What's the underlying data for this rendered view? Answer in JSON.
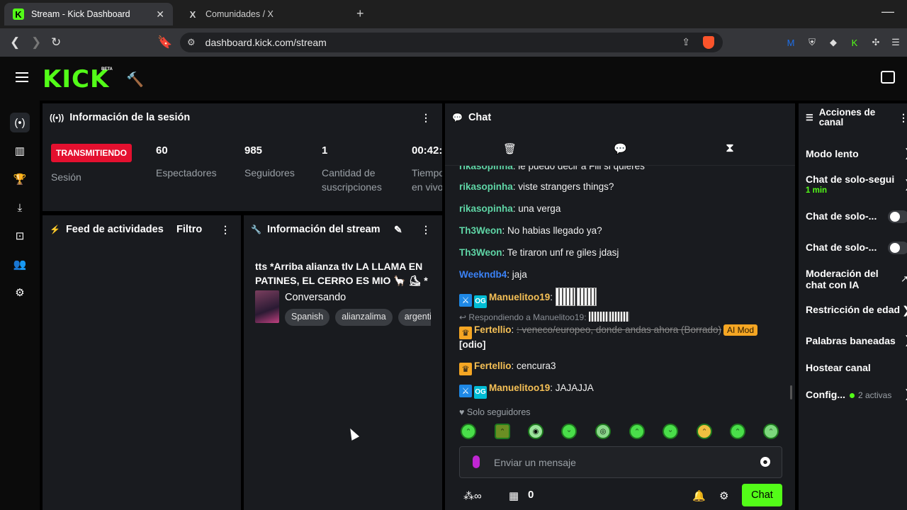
{
  "browser": {
    "tabs": [
      {
        "title": "Stream - Kick Dashboard",
        "favicon": "K"
      },
      {
        "title": "Comunidades / X",
        "favicon": "X"
      }
    ],
    "url": "dashboard.kick.com/stream"
  },
  "app": {
    "logo": "KICK",
    "beta": "BETA"
  },
  "session": {
    "title": "Información de la sesión",
    "status_badge": "TRANSMITIENDO",
    "status_label": "Sesión",
    "stats": [
      {
        "value": "60",
        "label": "Espectadores"
      },
      {
        "value": "985",
        "label": "Seguidores"
      },
      {
        "value": "1",
        "label": "Cantidad de suscripciones"
      },
      {
        "value": "00:42:",
        "label": "Tiempo en vivo"
      }
    ]
  },
  "feed": {
    "title": "Feed de actividades",
    "filter": "Filtro"
  },
  "stream_info": {
    "title": "Información del stream",
    "stream_title": "tts *Arriba alianza tlv LA LLAMA EN PATINES, EL CERRO ES MIO 🦙 ⛸ *",
    "category": "Conversando",
    "tags": [
      "Spanish",
      "alianzalima",
      "argentina"
    ]
  },
  "chat": {
    "title": "Chat",
    "messages": [
      {
        "user": "rikasopinha",
        "text": ": le puedo decir a Fili si quieres"
      },
      {
        "user": "rikasopinha",
        "text": ": viste strangers things?"
      },
      {
        "user": "rikasopinha",
        "text": ": una verga"
      },
      {
        "user": "Th3Weon",
        "text": ": No habias llegado ya?"
      },
      {
        "user": "Th3Weon",
        "text": ": Te tiraron unf re giles jdasj"
      },
      {
        "user": "Weekndb4",
        "text": ": jaja"
      },
      {
        "user": "Manuelitoo19",
        "text": ":"
      },
      {
        "reply": "Respondiendo a Manuelitoo19:",
        "user": "Fertellio",
        "text": ": veneco/europeo, donde andas ahora (Borrado)",
        "tag": "AI Mod",
        "extra": "[odio]"
      },
      {
        "user": "Fertellio",
        "text": ": cencura3"
      },
      {
        "user": "Manuelitoo19",
        "text": ": JAJAJJA"
      }
    ],
    "followers_only": "Solo seguidores",
    "placeholder": "Enviar un mensaje",
    "count": "0",
    "send_label": "Chat"
  },
  "actions": {
    "title": "Acciones de canal",
    "items": [
      {
        "label": "Modo lento"
      },
      {
        "label": "Chat de solo-segui",
        "sub": "1 min"
      },
      {
        "label": "Chat de solo-..."
      },
      {
        "label": "Chat de solo-..."
      },
      {
        "label": "Moderación del chat con IA"
      },
      {
        "label": "Restricción de edad"
      },
      {
        "label": "Palabras baneadas"
      },
      {
        "label": "Hostear canal"
      },
      {
        "label": "Config...",
        "sub": "2 activas"
      }
    ]
  },
  "colors": {
    "brand": "#53fc18",
    "live": "#e4102f",
    "panel": "#191b1f"
  }
}
